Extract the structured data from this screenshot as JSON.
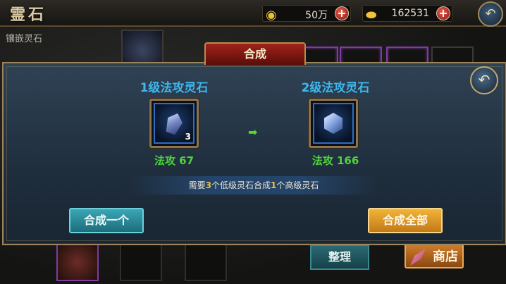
{
  "header": {
    "title": "霊石",
    "copper_amount": "50万",
    "gold_amount": "162531",
    "copper_icon": "coin-icon",
    "gold_icon": "gold-ingot-icon"
  },
  "background": {
    "inlay_label": "镶嵌灵石"
  },
  "dialog": {
    "tab_label": "合成",
    "source": {
      "name": "1级法攻灵石",
      "count": "3",
      "stat": "法攻 67"
    },
    "target": {
      "name": "2级法攻灵石",
      "stat": "法攻 166"
    },
    "requirement": {
      "prefix": "需要",
      "low_count": "3",
      "middle": "个低级灵石合成",
      "high_count": "1",
      "suffix": "个高级灵石"
    },
    "synth_one_label": "合成一个",
    "synth_all_label": "合成全部"
  },
  "bottom": {
    "sort_label": "整理",
    "shop_label": "商店"
  },
  "colors": {
    "title_blue": "#3fb6ec",
    "stat_green": "#4fd43a",
    "highlight_yellow": "#f0c33b"
  }
}
